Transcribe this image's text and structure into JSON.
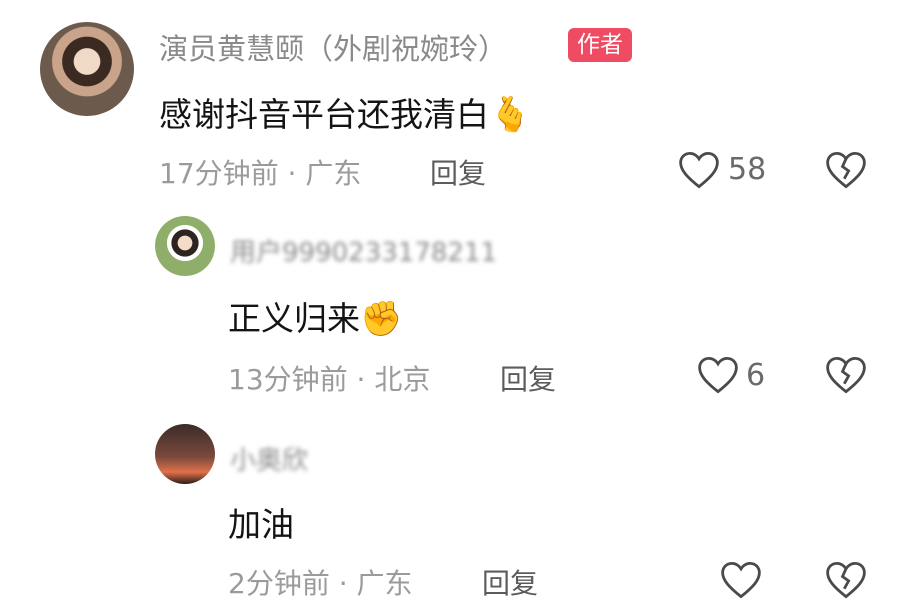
{
  "comments": [
    {
      "username": "演员黄慧颐（外剧祝婉玲）",
      "badge": "作者",
      "text": "感谢抖音平台还我清白",
      "emoji": "🫰",
      "time": "17分钟前",
      "location": "广东",
      "reply_label": "回复",
      "likes": "58"
    },
    {
      "username": "用户9990233178211",
      "text": "正义归来",
      "emoji": "✊",
      "time": "13分钟前",
      "location": "北京",
      "reply_label": "回复",
      "likes": "6"
    },
    {
      "username": "小奥欣",
      "text": "加油",
      "time": "2分钟前",
      "location": "广东",
      "reply_label": "回复"
    }
  ],
  "separator": "·",
  "icons": {
    "like": "heart-outline-icon",
    "dislike": "broken-heart-icon"
  },
  "colors": {
    "badge": "#ef4b63",
    "text": "#141414",
    "meta": "#9b9b9b"
  }
}
